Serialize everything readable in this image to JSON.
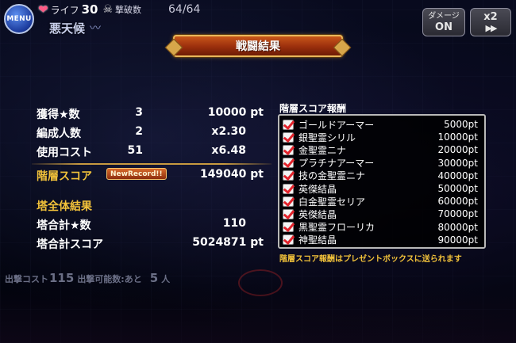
{
  "header": {
    "menu_label": "MENU",
    "life_label": "ライフ",
    "life_value": "30",
    "kill_label": "撃破数",
    "kill_count": "64/64",
    "weather_label": "悪天候",
    "damage_button": {
      "label": "ダメージ",
      "state": "ON"
    },
    "speed_button": {
      "label": "x2",
      "icon": "▶▶"
    }
  },
  "title": "戦闘結果",
  "results": {
    "rows": [
      {
        "label": "獲得★数",
        "value": "3",
        "detail": "10000 pt"
      },
      {
        "label": "編成人数",
        "value": "2",
        "detail": "x2.30"
      },
      {
        "label": "使用コスト",
        "value": "51",
        "detail": "x6.48"
      }
    ],
    "floor_score_label": "階層スコア",
    "new_record": "NewRecord!!",
    "floor_score_value": "149040 pt",
    "tower_header": "塔全体結果",
    "tower_stars_label": "塔合計★数",
    "tower_stars_value": "110",
    "tower_score_label": "塔合計スコア",
    "tower_score_value": "5024871 pt"
  },
  "sortie": {
    "cost_label": "出撃コスト",
    "cost_value": "115",
    "remaining_label": "出撃可能数:あと",
    "remaining_value": "5",
    "remaining_unit": "人"
  },
  "rewards": {
    "title": "階層スコア報酬",
    "items": [
      {
        "name": "ゴールドアーマー",
        "points": "5000pt"
      },
      {
        "name": "銀聖霊シリル",
        "points": "10000pt"
      },
      {
        "name": "金聖霊ニナ",
        "points": "20000pt"
      },
      {
        "name": "プラチナアーマー",
        "points": "30000pt"
      },
      {
        "name": "技の金聖霊ニナ",
        "points": "40000pt"
      },
      {
        "name": "英傑結晶",
        "points": "50000pt"
      },
      {
        "name": "白金聖霊セリア",
        "points": "60000pt"
      },
      {
        "name": "英傑結晶",
        "points": "70000pt"
      },
      {
        "name": "黒聖霊フローリカ",
        "points": "80000pt"
      },
      {
        "name": "神聖結晶",
        "points": "90000pt"
      }
    ],
    "note": "階層スコア報酬はプレゼントボックスに送られます"
  },
  "colors": {
    "accent_gold": "#f2c23a",
    "check_red": "#e2232b",
    "banner_orange": "#9a2e0c"
  }
}
